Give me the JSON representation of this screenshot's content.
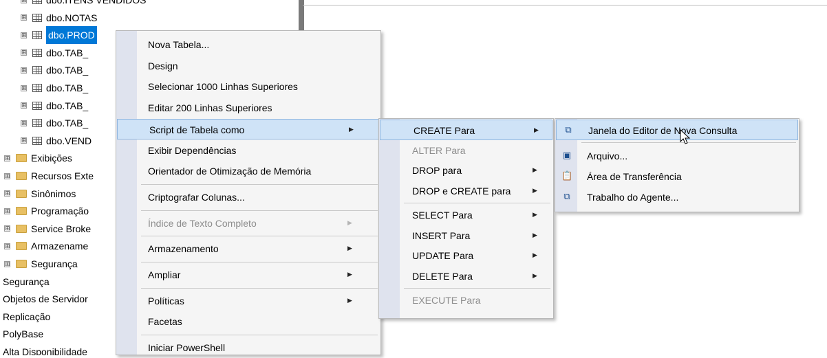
{
  "tree": {
    "items": [
      {
        "label": "dbo.ITENS VENDIDOS",
        "kind": "table",
        "expand": "⊞"
      },
      {
        "label": "dbo.NOTAS",
        "kind": "table",
        "expand": "⊞"
      },
      {
        "label": "dbo.PROD",
        "kind": "table",
        "expand": "⊞",
        "selected": true
      },
      {
        "label": "dbo.TAB_",
        "kind": "table",
        "expand": "⊞"
      },
      {
        "label": "dbo.TAB_",
        "kind": "table",
        "expand": "⊞"
      },
      {
        "label": "dbo.TAB_",
        "kind": "table",
        "expand": "⊞"
      },
      {
        "label": "dbo.TAB_",
        "kind": "table",
        "expand": "⊞"
      },
      {
        "label": "dbo.TAB_",
        "kind": "table",
        "expand": "⊞"
      },
      {
        "label": "dbo.VEND",
        "kind": "table",
        "expand": "⊞"
      },
      {
        "label": "Exibições",
        "kind": "folder",
        "expand": "⊞"
      },
      {
        "label": "Recursos Exte",
        "kind": "folder",
        "expand": "⊞"
      },
      {
        "label": "Sinônimos",
        "kind": "folder",
        "expand": "⊞"
      },
      {
        "label": "Programação",
        "kind": "folder",
        "expand": "⊞"
      },
      {
        "label": "Service Broke",
        "kind": "folder",
        "expand": "⊞"
      },
      {
        "label": "Armazename",
        "kind": "folder",
        "expand": "⊞"
      },
      {
        "label": "Segurança",
        "kind": "folder",
        "expand": "⊞"
      },
      {
        "label": "Segurança",
        "kind": "plain"
      },
      {
        "label": "Objetos de Servidor",
        "kind": "plain"
      },
      {
        "label": "Replicação",
        "kind": "plain"
      },
      {
        "label": "PolyBase",
        "kind": "plain"
      },
      {
        "label": "Alta Disponibilidade",
        "kind": "plain"
      }
    ]
  },
  "menu1": {
    "items": [
      {
        "label": "Nova Tabela..."
      },
      {
        "label": "Design"
      },
      {
        "label": "Selecionar 1000 Linhas Superiores"
      },
      {
        "label": "Editar 200 Linhas Superiores"
      },
      {
        "label": "Script de Tabela como",
        "submenu": true,
        "highlighted": true
      },
      {
        "label": "Exibir Dependências"
      },
      {
        "label": "Orientador de Otimização de Memória"
      },
      {
        "label": "Criptografar Colunas..."
      },
      {
        "label": "Índice de Texto Completo",
        "submenu": true,
        "disabled": true
      },
      {
        "label": "Armazenamento",
        "submenu": true
      },
      {
        "label": "Ampliar",
        "submenu": true
      },
      {
        "label": "Políticas",
        "submenu": true
      },
      {
        "label": "Facetas"
      },
      {
        "label": "Iniciar PowerShell"
      }
    ]
  },
  "menu2": {
    "items": [
      {
        "label": "CREATE Para",
        "submenu": true,
        "highlighted": true
      },
      {
        "label": "ALTER Para",
        "disabled": true
      },
      {
        "label": "DROP para",
        "submenu": true
      },
      {
        "label": "DROP e CREATE para",
        "submenu": true
      },
      {
        "label": "SELECT Para",
        "submenu": true
      },
      {
        "label": "INSERT Para",
        "submenu": true
      },
      {
        "label": "UPDATE Para",
        "submenu": true
      },
      {
        "label": "DELETE Para",
        "submenu": true
      },
      {
        "label": "EXECUTE Para",
        "disabled": true
      }
    ]
  },
  "menu3": {
    "items": [
      {
        "label": "Janela do Editor de Nova Consulta",
        "icon": "new-query-window-icon",
        "glyph": "⧉",
        "highlighted": true
      },
      {
        "label": "Arquivo...",
        "icon": "save-file-icon",
        "glyph": "▣"
      },
      {
        "label": "Área de Transferência",
        "icon": "clipboard-icon",
        "glyph": "📋"
      },
      {
        "label": "Trabalho do Agente...",
        "icon": "agent-job-icon",
        "glyph": "⧉"
      }
    ]
  },
  "arrow_glyph": "▶",
  "colors": {
    "selection": "#0078d7",
    "highlight": "#cfe3f7",
    "gutter": "#dfe3ee"
  }
}
